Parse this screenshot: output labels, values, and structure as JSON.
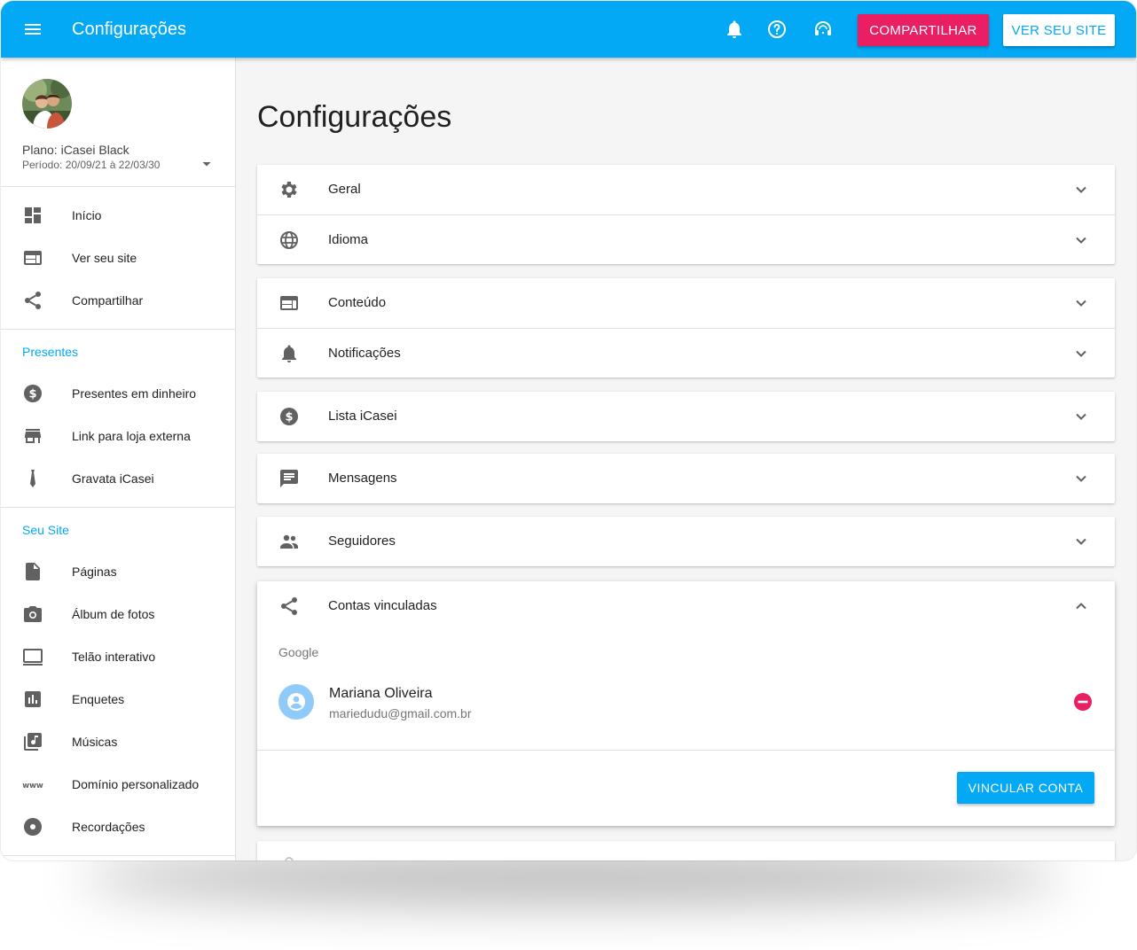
{
  "topbar": {
    "title": "Configurações",
    "share_label": "COMPARTILHAR",
    "site_label": "VER SEU SITE"
  },
  "sidebar": {
    "plan": "Plano: iCasei Black",
    "period": "Período: 20/09/21 à 22/03/30",
    "main_items": [
      {
        "label": "Início",
        "icon": "dashboard-icon"
      },
      {
        "label": "Ver seu site",
        "icon": "web-icon"
      },
      {
        "label": "Compartilhar",
        "icon": "share-icon"
      }
    ],
    "presentes": {
      "header": "Presentes",
      "items": [
        {
          "label": "Presentes em dinheiro",
          "icon": "money-icon"
        },
        {
          "label": "Link para loja externa",
          "icon": "store-icon"
        },
        {
          "label": "Gravata iCasei",
          "icon": "tie-icon"
        }
      ]
    },
    "seu_site": {
      "header": "Seu Site",
      "items": [
        {
          "label": "Páginas",
          "icon": "page-icon"
        },
        {
          "label": "Álbum de fotos",
          "icon": "camera-icon"
        },
        {
          "label": "Telão interativo",
          "icon": "monitor-icon"
        },
        {
          "label": "Enquetes",
          "icon": "poll-icon"
        },
        {
          "label": "Músicas",
          "icon": "music-icon"
        },
        {
          "label": "Domínio personalizado",
          "icon": "www-icon"
        },
        {
          "label": "Recordações",
          "icon": "disc-icon"
        }
      ]
    }
  },
  "main": {
    "title": "Configurações",
    "panels": {
      "geral": "Geral",
      "idioma": "Idioma",
      "conteudo": "Conteúdo",
      "notificacoes": "Notificações",
      "lista": "Lista iCasei",
      "mensagens": "Mensagens",
      "seguidores": "Seguidores",
      "contas": "Contas vinculadas"
    },
    "linked": {
      "provider": "Google",
      "name": "Mariana Oliveira",
      "email": "mariedudu@gmail.com.br",
      "link_button": "VINCULAR CONTA"
    }
  },
  "colors": {
    "primary": "#03a9f4",
    "accent": "#e91e63",
    "remove": "#e91e63"
  }
}
